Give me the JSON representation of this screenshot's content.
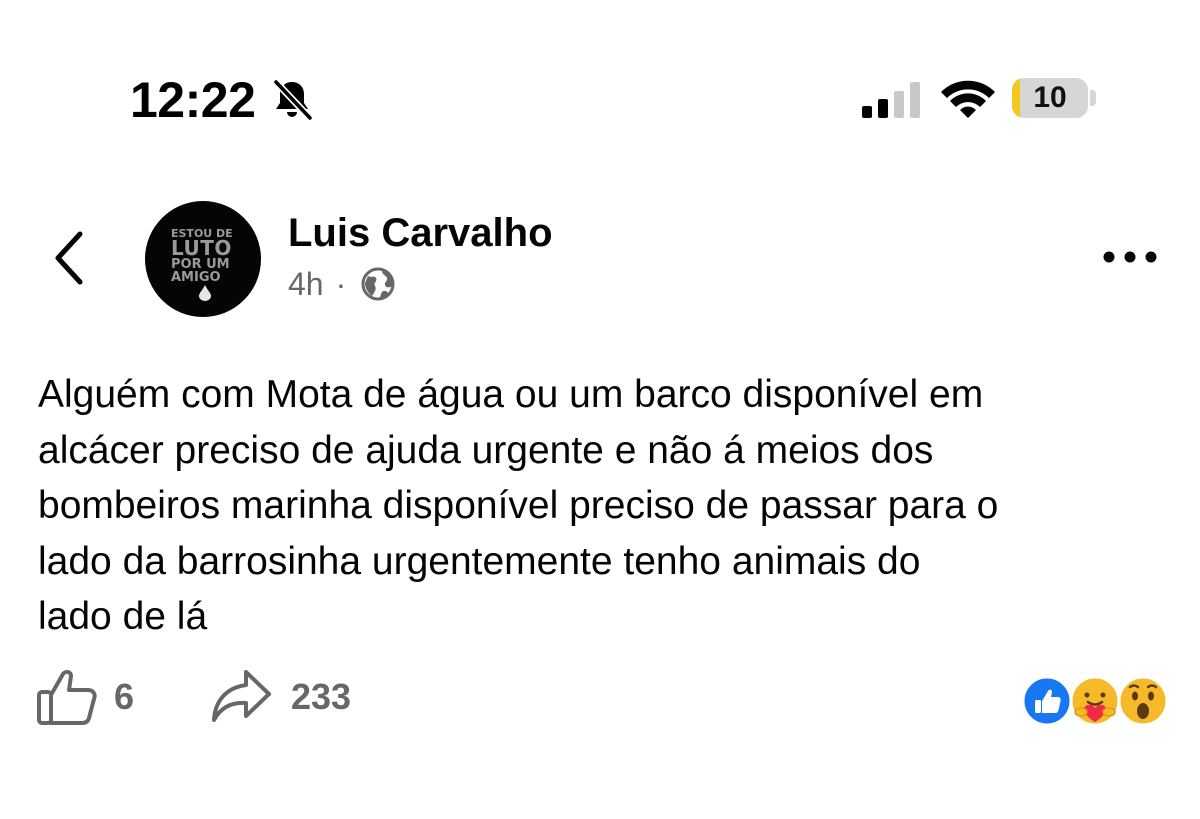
{
  "status_bar": {
    "time": "12:22",
    "battery_percent": "10",
    "battery_level": 0.1,
    "signal_bars_active": 2,
    "signal_bars_total": 4,
    "icons": [
      "bell-slash-icon",
      "cellular-signal-icon",
      "wifi-icon",
      "battery-icon"
    ]
  },
  "header": {
    "back_icon": "chevron-left-icon",
    "more_icon": "more-horizontal-icon"
  },
  "post": {
    "author": "Luis Carvalho",
    "avatar": {
      "line1": "ESTOU DE",
      "line2": "LUTO",
      "line3": "POR UM",
      "line4": "AMIGO"
    },
    "time_ago": "4h",
    "separator": "·",
    "privacy_icon": "globe-icon",
    "text": "Alguém com Mota de água ou um barco disponível em\nalcácer preciso de ajuda urgente e não á meios dos\nbombeiros marinha disponível preciso de passar para o\nlado da barrosinha urgentemente tenho animais do\nlado de lá"
  },
  "footer": {
    "like_count": "6",
    "share_count": "233",
    "reactions": [
      "like-reaction",
      "care-reaction",
      "wow-reaction"
    ]
  },
  "colors": {
    "text_primary": "#050505",
    "text_secondary": "#65676b",
    "like_blue": "#1877f2",
    "battery_yellow": "#f5c81b",
    "reaction_yellow": "#f7b928"
  }
}
